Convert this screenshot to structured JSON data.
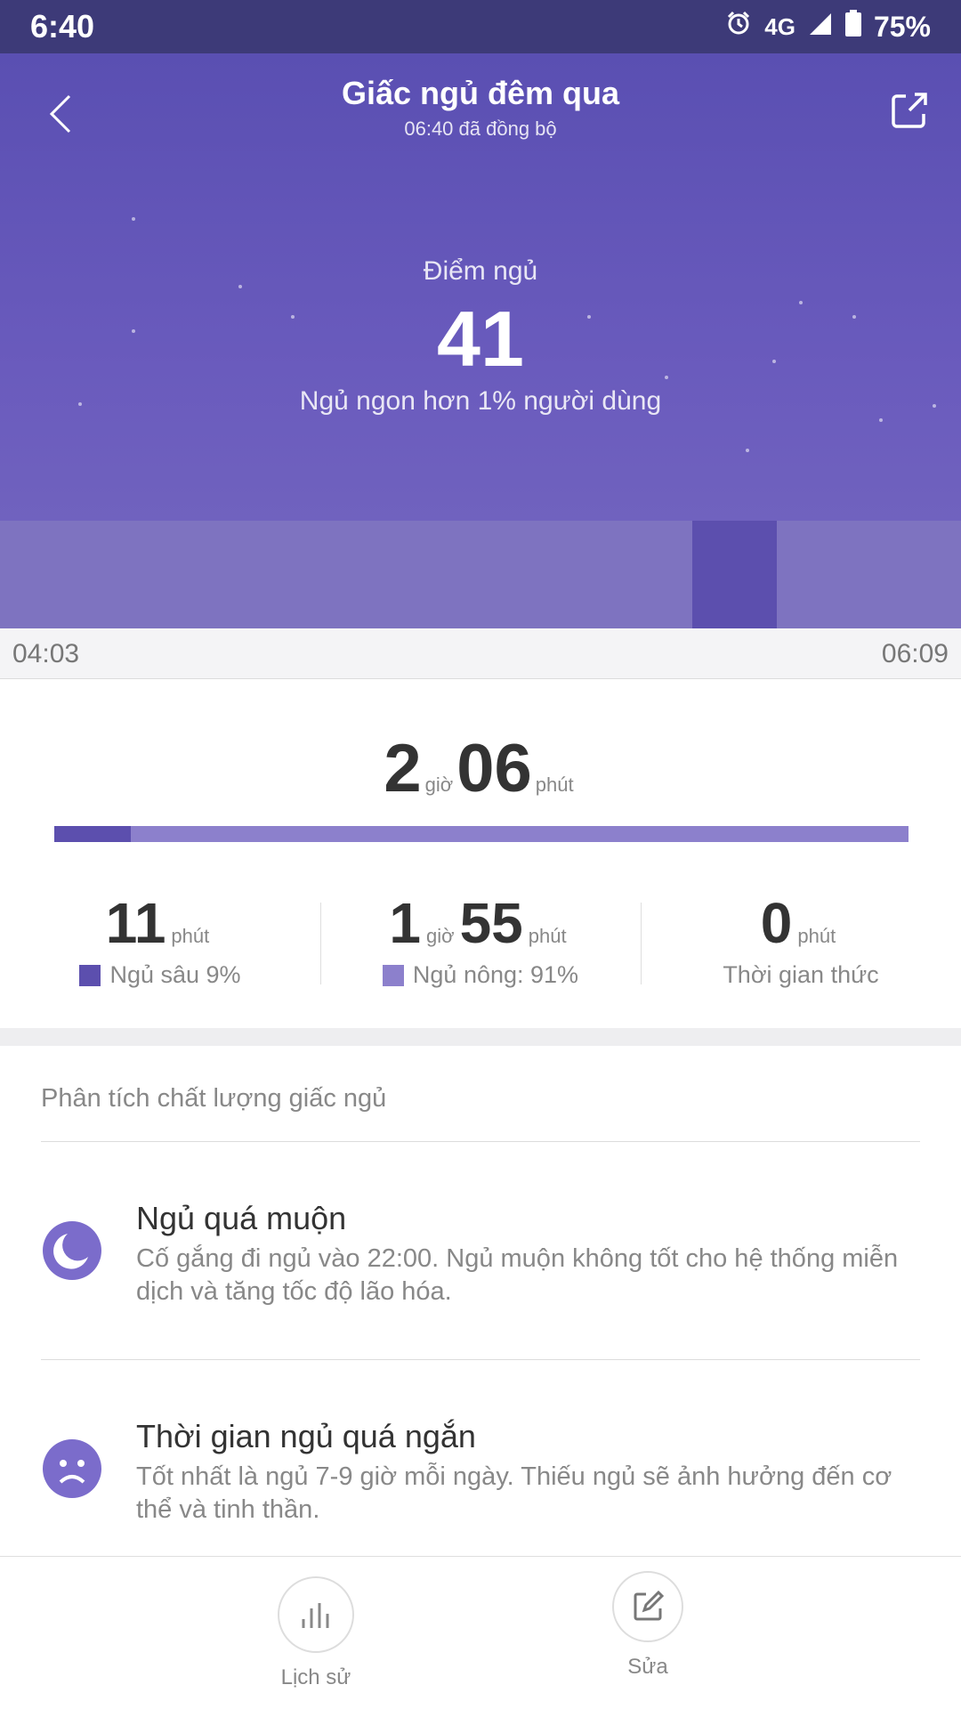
{
  "status_bar": {
    "time": "6:40",
    "network": "4G",
    "battery": "75%"
  },
  "header": {
    "title": "Giấc ngủ đêm qua",
    "subtitle": "06:40 đã đồng bộ"
  },
  "score": {
    "label": "Điểm ngủ",
    "value": "41",
    "description": "Ngủ ngon hơn 1% người dùng"
  },
  "timeline": {
    "start": "04:03",
    "end": "06:09"
  },
  "duration": {
    "hours": "2",
    "hours_unit": "giờ",
    "minutes": "06",
    "minutes_unit": "phút",
    "deep_fraction": 0.09
  },
  "stats": {
    "deep": {
      "value": "11",
      "unit": "phút",
      "label": "Ngủ sâu 9%"
    },
    "light": {
      "hours": "1",
      "hours_unit": "giờ",
      "minutes": "55",
      "minutes_unit": "phút",
      "label": "Ngủ nông: 91%"
    },
    "awake": {
      "value": "0",
      "unit": "phút",
      "label": "Thời gian thức"
    }
  },
  "analysis": {
    "title": "Phân tích chất lượng giấc ngủ",
    "items": [
      {
        "title": "Ngủ quá muộn",
        "description": "Cố gắng đi ngủ vào 22:00. Ngủ muộn không tốt cho hệ thống miễn dịch và tăng tốc độ lão hóa.",
        "icon": "moon-icon"
      },
      {
        "title": "Thời gian ngủ quá ngắn",
        "description": "Tốt nhất là ngủ 7-9 giờ mỗi ngày. Thiếu ngủ sẽ ảnh hưởng đến cơ thể và tinh thần.",
        "icon": "sad-face-icon"
      }
    ]
  },
  "bottom_bar": {
    "history_label": "Lịch sử",
    "edit_label": "Sửa"
  },
  "colors": {
    "primary": "#5c4fae",
    "light": "#8c80cc",
    "accent": "#7b6ccb"
  }
}
